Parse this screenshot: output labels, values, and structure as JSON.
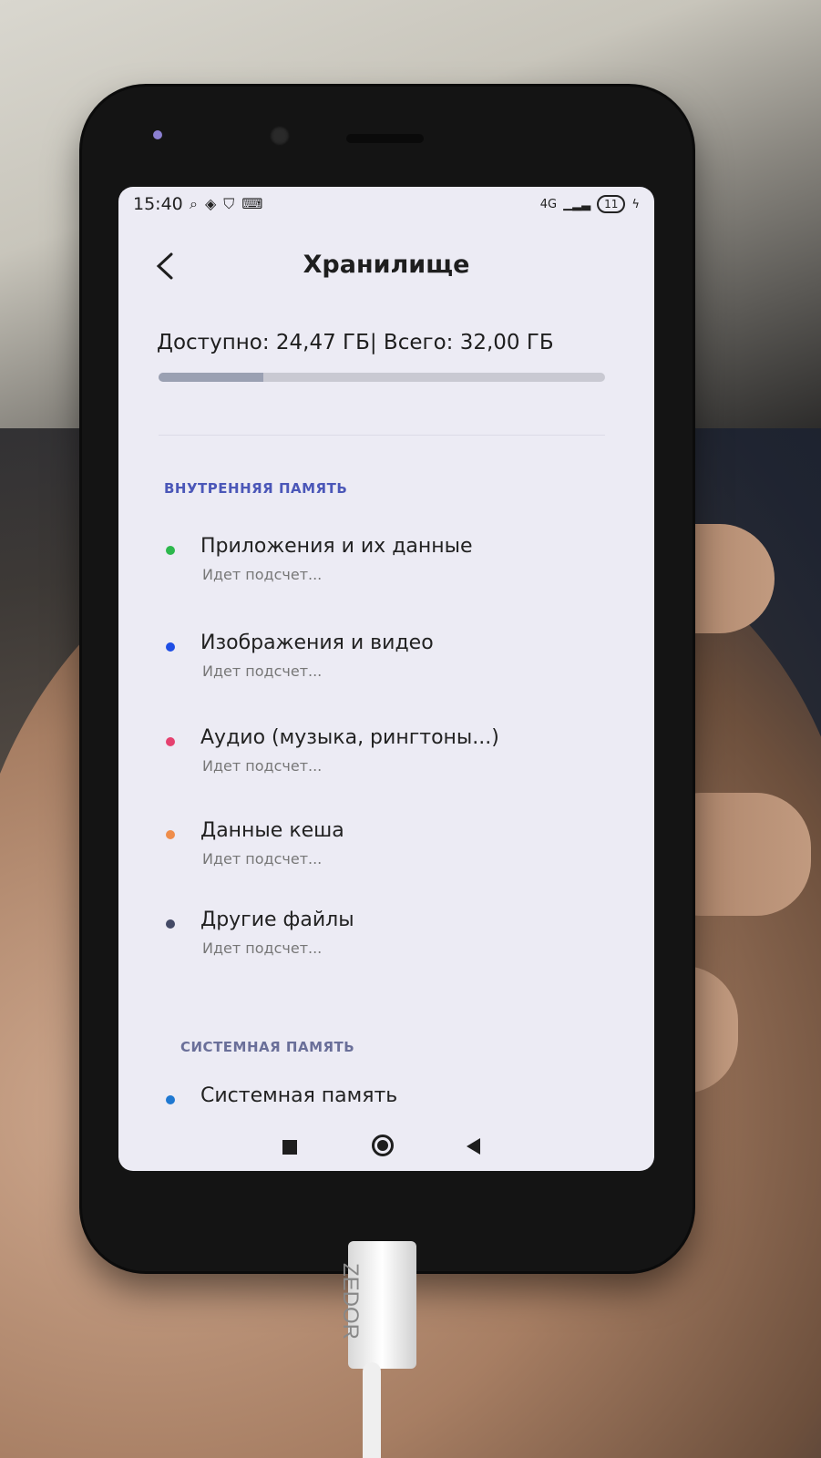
{
  "status_bar": {
    "time": "15:40",
    "icons": [
      "location-icon",
      "app-icon",
      "shield-icon",
      "keyboard-icon"
    ],
    "network": "4G",
    "battery": "11"
  },
  "header": {
    "title": "Хранилище",
    "back_icon": "back-arrow-icon"
  },
  "storage": {
    "summary": "Доступно: 24,47 ГБ| Всего: 32,00 ГБ",
    "used_fraction": 0.2353
  },
  "sections": {
    "internal_label": "ВНУТРЕННЯЯ ПАМЯТЬ",
    "system_label": "СИСТЕМНАЯ ПАМЯТЬ"
  },
  "items": [
    {
      "title": "Приложения и их данные",
      "subtitle": "Идет подсчет...",
      "color": "#2db84d"
    },
    {
      "title": "Изображения и видео",
      "subtitle": "Идет подсчет...",
      "color": "#1f4ee5"
    },
    {
      "title": "Аудио (музыка, рингтоны...)",
      "subtitle": "Идет подсчет...",
      "color": "#e5416f"
    },
    {
      "title": "Данные кеша",
      "subtitle": "Идет подсчет...",
      "color": "#ef8d4b"
    },
    {
      "title": "Другие файлы",
      "subtitle": "Идет подсчет...",
      "color": "#444a66"
    },
    {
      "title": "Системная память",
      "subtitle": "",
      "color": "#1f78d1"
    }
  ],
  "nav": {
    "recent": "recent-apps-icon",
    "home": "home-icon",
    "back": "back-icon"
  },
  "cable_label": "ZEDOR"
}
